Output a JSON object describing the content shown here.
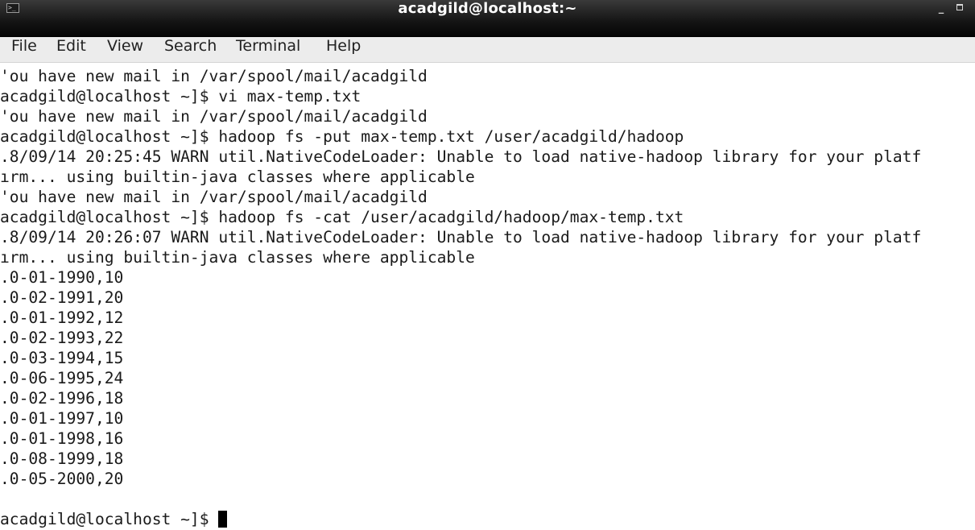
{
  "window": {
    "title": "acadgild@localhost:~",
    "icon": "terminal-icon",
    "icon_glyph": ">_",
    "minimize_glyph": "_"
  },
  "menu": {
    "items": [
      "File",
      "Edit",
      "View",
      "Search",
      "Terminal",
      "Help"
    ]
  },
  "terminal": {
    "lines": [
      "'ou have new mail in /var/spool/mail/acadgild",
      "acadgild@localhost ~]$ vi max-temp.txt",
      "'ou have new mail in /var/spool/mail/acadgild",
      "acadgild@localhost ~]$ hadoop fs -put max-temp.txt /user/acadgild/hadoop",
      ".8/09/14 20:25:45 WARN util.NativeCodeLoader: Unable to load native-hadoop library for your platf",
      "ırm... using builtin-java classes where applicable",
      "'ou have new mail in /var/spool/mail/acadgild",
      "acadgild@localhost ~]$ hadoop fs -cat /user/acadgild/hadoop/max-temp.txt",
      ".8/09/14 20:26:07 WARN util.NativeCodeLoader: Unable to load native-hadoop library for your platf",
      "ırm... using builtin-java classes where applicable",
      ".0-01-1990,10",
      ".0-02-1991,20",
      ".0-01-1992,12",
      ".0-02-1993,22",
      ".0-03-1994,15",
      ".0-06-1995,24",
      ".0-02-1996,18",
      ".0-01-1997,10",
      ".0-01-1998,16",
      ".0-08-1999,18",
      ".0-05-2000,20"
    ],
    "prompt": "acadgild@localhost ~]$ "
  }
}
